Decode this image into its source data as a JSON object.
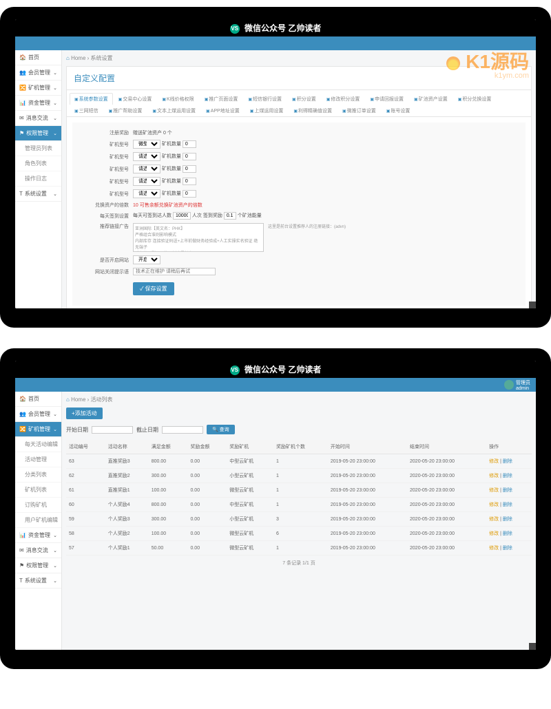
{
  "titlebar": "微信公众号  乙帅读者",
  "watermark": {
    "brand": "K1源码",
    "url": "k1ym.com"
  },
  "user": {
    "role": "管理员",
    "name": "admin"
  },
  "breadcrumb1": {
    "home": "Home",
    "current": "系统设置"
  },
  "breadcrumb2": {
    "home": "Home",
    "current": "活动列表"
  },
  "nav1": [
    {
      "icon": "🏠",
      "label": "首页",
      "sub": false
    },
    {
      "icon": "👥",
      "label": "会员管理",
      "sub": true
    },
    {
      "icon": "🔀",
      "label": "矿机管理",
      "sub": true
    },
    {
      "icon": "📊",
      "label": "资金管理",
      "sub": true
    },
    {
      "icon": "✉",
      "label": "消息交流",
      "sub": true
    },
    {
      "icon": "⚑",
      "label": "权限管理",
      "sub": true,
      "active": true,
      "children": [
        "管理员列表",
        "角色列表",
        "操作日志"
      ]
    },
    {
      "icon": "T",
      "label": "系统设置",
      "sub": true
    }
  ],
  "nav2": [
    {
      "icon": "🏠",
      "label": "首页",
      "sub": false
    },
    {
      "icon": "👥",
      "label": "会员管理",
      "sub": true
    },
    {
      "icon": "🔀",
      "label": "矿机管理",
      "sub": true,
      "active": true,
      "children": [
        "每天活动编辑",
        "活动管理",
        "分类列表",
        "矿机列表",
        "订购矿机",
        "用户矿机编辑"
      ]
    },
    {
      "icon": "📊",
      "label": "资金管理",
      "sub": true
    },
    {
      "icon": "✉",
      "label": "消息交流",
      "sub": true
    },
    {
      "icon": "⚑",
      "label": "权限管理",
      "sub": true
    },
    {
      "icon": "T",
      "label": "系统设置",
      "sub": true
    }
  ],
  "card_title": "自定义配置",
  "tabs": [
    "系统参数设置",
    "交易中心设置",
    "K线价格权限",
    "推广页面设置",
    "短信银行设置",
    "积分设置",
    "修改积分设置",
    "申请回报设置",
    "矿池资产设置",
    "积分兑换设置",
    "三网短信",
    "推广帮助设置",
    "文本上煤运用设置",
    "APP地址设置",
    "上煤运用设置",
    "利得精确值设置",
    "微推订单设置",
    "账号设置"
  ],
  "form": {
    "reg_label": "注册奖励",
    "reg_hint": "赠送矿池资产 0  个",
    "kjx_label": "矿机型号",
    "kj_count_label": "矿机数量",
    "kj_opts": [
      "微型矿机",
      "请选择",
      "请选择",
      "请选择",
      "请选择"
    ],
    "kj_count": "0",
    "exchange_label": "兑换资产的倍数",
    "exchange_val": "10",
    "exchange_hint": "可售余额兑换矿池资产的倍数",
    "sign_label": "每天签到设置",
    "sign_text1": "每天可签到达人数",
    "sign_val": "10000",
    "sign_text2": "人次 签到奖励",
    "sign_bonus": "0.1",
    "sign_text3": "个矿池能量",
    "promo_label": "推荐链接广告",
    "promo_text": "亚洲国际【英文名：PHK】\n严格组合准则影响模式\n内部库存 连接验证码送+上市前做财务经验成+人工实操实名验证 绝无端子\n系有端子删不了的即刻才是长久项目",
    "promo_hint": "这里是前台设置推荐人的注册链接：(advn)",
    "open_label": "是否开启网站",
    "open_val": "开启",
    "close_label": "网站关闭提示语",
    "close_ph": "技术正在维护 请稍后再试",
    "save_btn": "✓ 保存设置"
  },
  "list": {
    "add_btn": "+添加活动",
    "start_label": "开始日期",
    "end_label": "截止日期",
    "query_btn": "查询",
    "cols": [
      "活动编号",
      "活动名称",
      "满足金额",
      "奖励金额",
      "奖励矿机",
      "奖励矿机个数",
      "开始时间",
      "结束时间",
      "操作"
    ],
    "rows": [
      [
        "63",
        "直推奖励3",
        "800.00",
        "0.00",
        "中型云矿机",
        "1",
        "2019-05-20 23:00:00",
        "2020-05-20 23:00:00"
      ],
      [
        "62",
        "直推奖励2",
        "300.00",
        "0.00",
        "小型云矿机",
        "1",
        "2019-05-20 23:00:00",
        "2020-05-20 23:00:00"
      ],
      [
        "61",
        "直推奖励1",
        "100.00",
        "0.00",
        "微型云矿机",
        "1",
        "2019-05-20 23:00:00",
        "2020-05-20 23:00:00"
      ],
      [
        "60",
        "个人奖励4",
        "800.00",
        "0.00",
        "中型云矿机",
        "1",
        "2019-05-20 23:00:00",
        "2020-05-20 23:00:00"
      ],
      [
        "59",
        "个人奖励3",
        "300.00",
        "0.00",
        "小型云矿机",
        "3",
        "2019-05-20 23:00:00",
        "2020-05-20 23:00:00"
      ],
      [
        "58",
        "个人奖励2",
        "100.00",
        "0.00",
        "微型云矿机",
        "6",
        "2019-05-20 23:00:00",
        "2020-05-20 23:00:00"
      ],
      [
        "57",
        "个人奖励1",
        "50.00",
        "0.00",
        "微型云矿机",
        "1",
        "2019-05-20 23:00:00",
        "2020-05-20 23:00:00"
      ]
    ],
    "op_edit": "修改",
    "op_del": "删除",
    "pager": "7 条记录 1/1 页"
  }
}
